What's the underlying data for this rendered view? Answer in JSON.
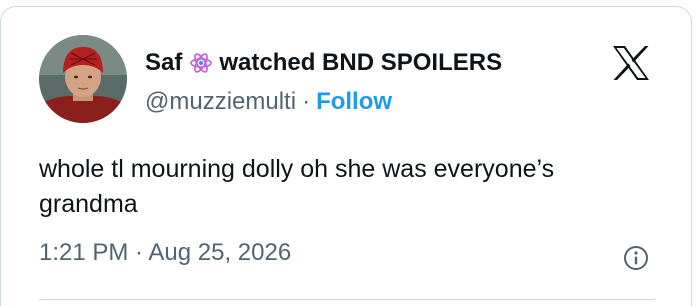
{
  "tweet": {
    "display_name": "Saf",
    "display_name_suffix": "watched BND SPOILERS",
    "name_emoji": "atom-emoji",
    "handle": "@muzziemulti",
    "separator": "·",
    "follow_label": "Follow",
    "text": "whole tl mourning dolly oh she was everyone’s grandma",
    "timestamp": "1:21 PM · Aug 25, 2026"
  },
  "icons": {
    "brand": "x-logo-icon",
    "info": "info-icon"
  },
  "colors": {
    "text": "#0f1419",
    "secondary": "#536471",
    "accent": "#1d9bf0",
    "border": "#cfd9de"
  }
}
